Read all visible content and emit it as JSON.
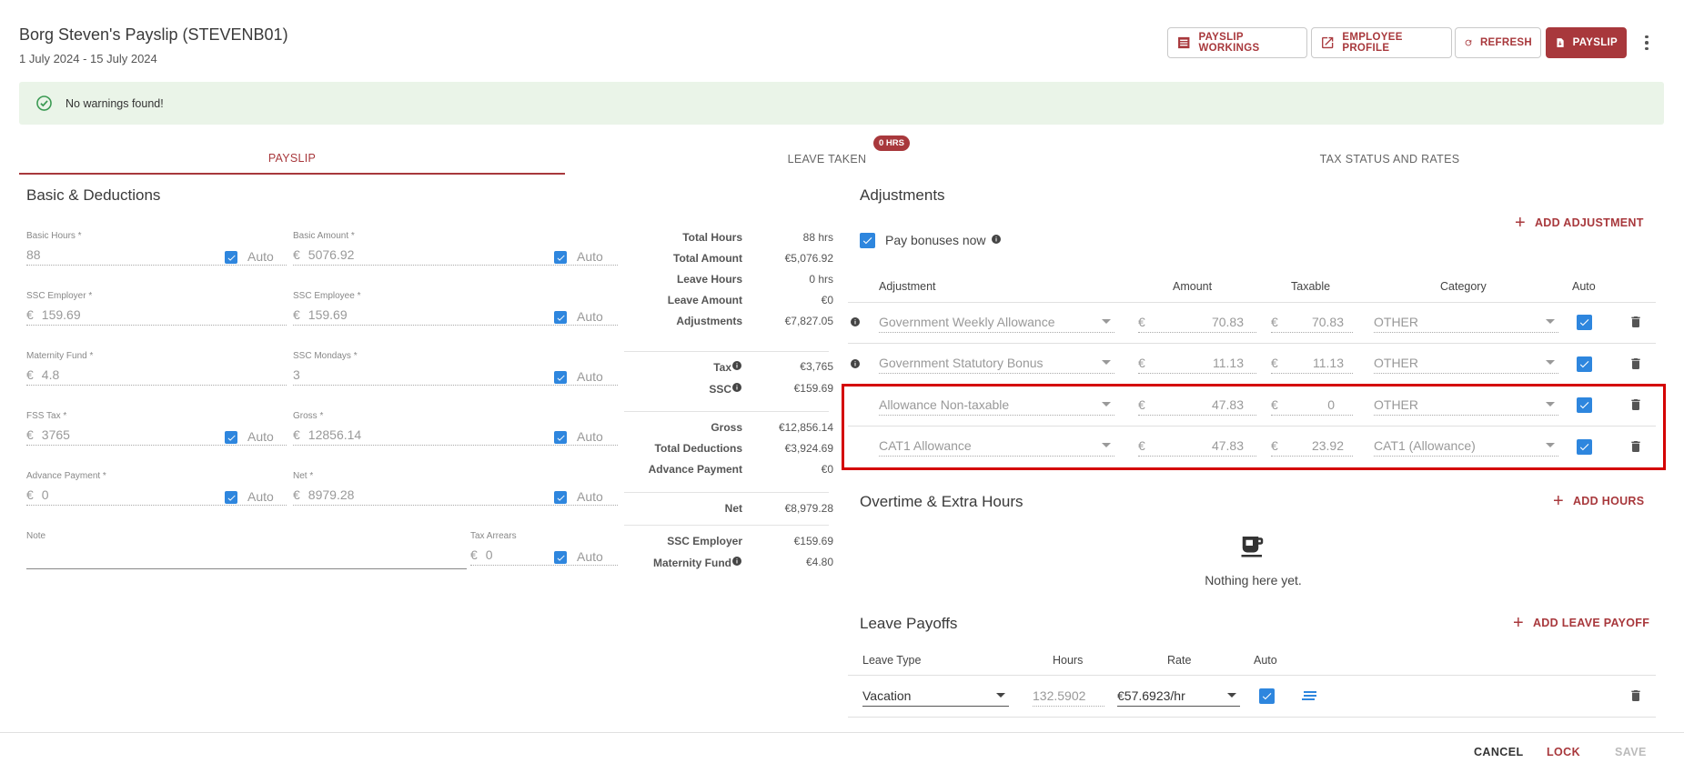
{
  "header": {
    "title": "Borg Steven's Payslip (STEVENB01)",
    "period": "1 July 2024 - 15 July 2024"
  },
  "actions": {
    "workings": "PAYSLIP WORKINGS",
    "profile": "EMPLOYEE PROFILE",
    "refresh": "REFRESH",
    "payslip": "PAYSLIP"
  },
  "alert": {
    "text": "No warnings found!"
  },
  "tabs": {
    "payslip": "PAYSLIP",
    "leave": "LEAVE TAKEN",
    "leave_badge": "0 HRS",
    "tax": "TAX STATUS AND RATES"
  },
  "basic": {
    "title": "Basic & Deductions",
    "auto": "Auto",
    "currency": "€",
    "basic_hours": {
      "label": "Basic Hours *",
      "value": "88"
    },
    "basic_amount": {
      "label": "Basic Amount *",
      "value": "5076.92"
    },
    "ssc_employer": {
      "label": "SSC Employer *",
      "value": "159.69"
    },
    "ssc_employee": {
      "label": "SSC Employee *",
      "value": "159.69"
    },
    "maternity": {
      "label": "Maternity Fund *",
      "value": "4.8"
    },
    "ssc_mondays": {
      "label": "SSC Mondays *",
      "value": "3"
    },
    "fss_tax": {
      "label": "FSS Tax *",
      "value": "3765"
    },
    "gross": {
      "label": "Gross *",
      "value": "12856.14"
    },
    "advance": {
      "label": "Advance Payment *",
      "value": "0"
    },
    "net": {
      "label": "Net *",
      "value": "8979.28"
    },
    "note": {
      "label": "Note",
      "value": ""
    },
    "tax_arrears": {
      "label": "Tax Arrears",
      "value": "0"
    }
  },
  "summary": {
    "g1": [
      {
        "label": "Total Hours",
        "value": "88 hrs"
      },
      {
        "label": "Total Amount",
        "value": "€5,076.92"
      },
      {
        "label": "Leave Hours",
        "value": "0 hrs"
      },
      {
        "label": "Leave Amount",
        "value": "€0"
      },
      {
        "label": "Adjustments",
        "value": "€7,827.05"
      }
    ],
    "tax": {
      "label": "Tax",
      "value": "€3,765"
    },
    "ssc": {
      "label": "SSC",
      "value": "€159.69"
    },
    "g3": [
      {
        "label": "Gross",
        "value": "€12,856.14"
      },
      {
        "label": "Total Deductions",
        "value": "€3,924.69"
      },
      {
        "label": "Advance Payment",
        "value": "€0"
      }
    ],
    "net": {
      "label": "Net",
      "value": "€8,979.28"
    },
    "ssc_employer": {
      "label": "SSC Employer",
      "value": "€159.69"
    },
    "maternity": {
      "label": "Maternity Fund",
      "value": "€4.80"
    }
  },
  "adjustments": {
    "title": "Adjustments",
    "pay_bonuses": "Pay bonuses now",
    "add": "ADD ADJUSTMENT",
    "headers": {
      "adjustment": "Adjustment",
      "amount": "Amount",
      "taxable": "Taxable",
      "category": "Category",
      "auto": "Auto"
    },
    "rows": [
      {
        "name": "Government Weekly Allowance",
        "amount": "70.83",
        "taxable": "70.83",
        "category": "OTHER"
      },
      {
        "name": "Government Statutory Bonus",
        "amount": "11.13",
        "taxable": "11.13",
        "category": "OTHER"
      },
      {
        "name": "Allowance Non-taxable",
        "amount": "47.83",
        "taxable": "0",
        "category": "OTHER"
      },
      {
        "name": "CAT1 Allowance",
        "amount": "47.83",
        "taxable": "23.92",
        "category": "CAT1 (Allowance)"
      }
    ]
  },
  "overtime": {
    "title": "Overtime & Extra Hours",
    "add": "ADD HOURS",
    "empty": "Nothing here yet."
  },
  "leave_payoffs": {
    "title": "Leave Payoffs",
    "add": "ADD LEAVE PAYOFF",
    "headers": {
      "type": "Leave Type",
      "hours": "Hours",
      "rate": "Rate",
      "auto": "Auto"
    },
    "row": {
      "type": "Vacation",
      "hours": "132.5902",
      "rate": "€57.6923/hr"
    }
  },
  "footer": {
    "cancel": "CANCEL",
    "lock": "LOCK",
    "save": "SAVE"
  }
}
